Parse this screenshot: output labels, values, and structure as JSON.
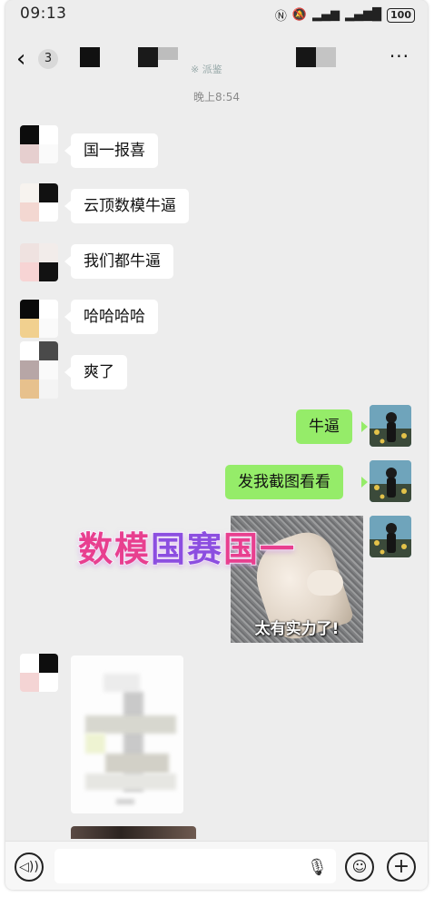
{
  "status_bar": {
    "time": "09:13",
    "icons": [
      "nfc-icon",
      "mute-icon",
      "signal-icon",
      "signal-icon"
    ],
    "battery": "100"
  },
  "header": {
    "back_glyph": "‹",
    "unread_count": "3",
    "subtitle": "※ 派鉴",
    "more_glyph": "···"
  },
  "timestamp": "晚上8:54",
  "messages": [
    {
      "side": "left",
      "text": "国一报喜"
    },
    {
      "side": "left",
      "text": "云顶数模牛逼"
    },
    {
      "side": "left",
      "text": "我们都牛逼"
    },
    {
      "side": "left",
      "text": "哈哈哈哈"
    },
    {
      "side": "left",
      "text": "爽了"
    },
    {
      "side": "right",
      "text": "牛逼"
    },
    {
      "side": "right",
      "text": "发我截图看看"
    }
  ],
  "sticker": {
    "banner": [
      "数模",
      "国赛",
      "国一"
    ],
    "caption": "太有实力了!"
  },
  "input_bar": {
    "placeholder": "",
    "voice_glyph": "◁))",
    "mic_glyph": "🎙",
    "emoji_glyph": "☺",
    "plus_glyph": "+"
  },
  "colors": {
    "bg": "#ededed",
    "bubble_me": "#95ec69",
    "bubble_other": "#ffffff",
    "banner_pink": "#e83f8f",
    "banner_purple": "#8c4ee0"
  }
}
